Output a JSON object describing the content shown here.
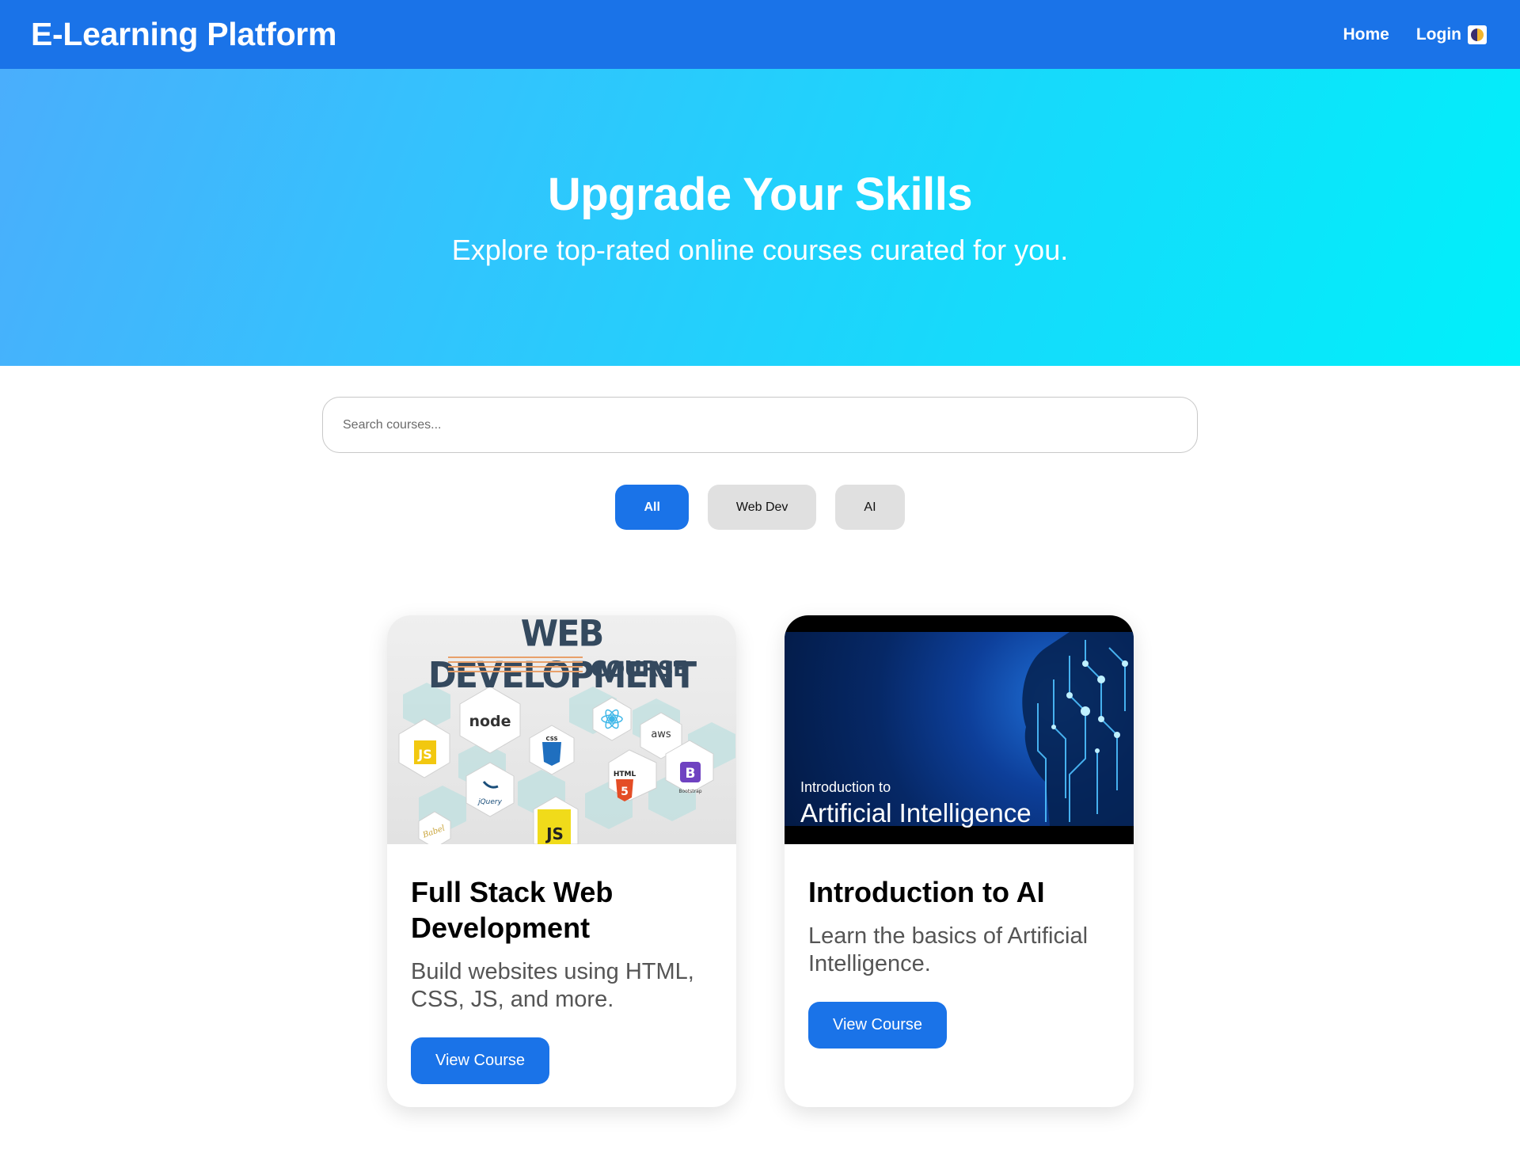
{
  "header": {
    "brand": "E-Learning Platform",
    "nav": {
      "home": "Home",
      "login": "Login"
    },
    "accent_color": "#1a73e8"
  },
  "hero": {
    "title": "Upgrade Your Skills",
    "subtitle": "Explore top-rated online courses curated for you."
  },
  "search": {
    "placeholder": "Search courses...",
    "value": ""
  },
  "filters": [
    {
      "label": "All",
      "active": true
    },
    {
      "label": "Web Dev",
      "active": false
    },
    {
      "label": "AI",
      "active": false
    }
  ],
  "courses": [
    {
      "title": "Full Stack Web Development",
      "description": "Build websites using HTML, CSS, JS, and more.",
      "cta": "View Course",
      "thumbnail": {
        "heading": "WEB DEVELOPMENT",
        "subheading": "COURSE",
        "logos": [
          "node",
          "JS",
          "CSS",
          "aws",
          "HTML",
          "B",
          "jQuery",
          "JS",
          "Babel"
        ]
      }
    },
    {
      "title": "Introduction to AI",
      "description": "Learn the basics of Artificial Intelligence.",
      "cta": "View Course",
      "thumbnail": {
        "small_text": "Introduction to",
        "big_text": "Artificial Intelligence"
      }
    }
  ]
}
